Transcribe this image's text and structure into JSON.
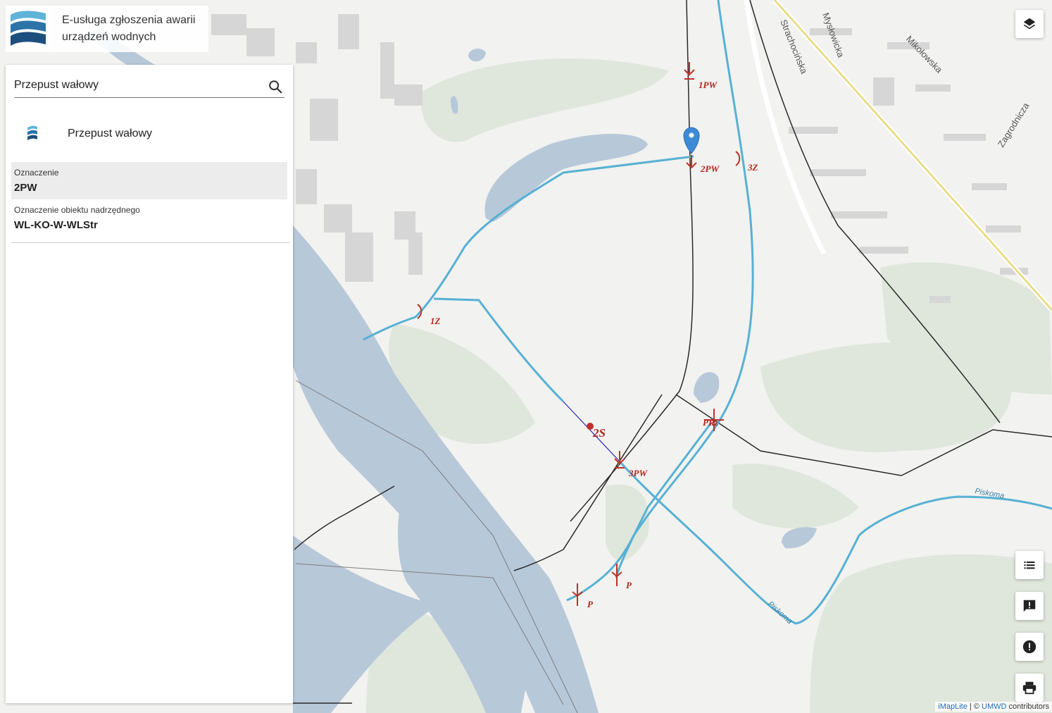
{
  "header": {
    "title": "E-usługa zgłoszenia awarii urządzeń wodnych"
  },
  "search": {
    "value": "Przepust wałowy",
    "placeholder": ""
  },
  "result": {
    "label": "Przepust wałowy"
  },
  "attributes": [
    {
      "name": "Oznaczenie",
      "value": "2PW"
    },
    {
      "name": "Oznaczenie obiektu nadrzędnego",
      "value": "WL-KO-W-WLStr"
    }
  ],
  "map": {
    "structure_labels": [
      "1PW",
      "2PW",
      "3Z",
      "1Z",
      "2S",
      "3PW",
      "PRz",
      "P",
      "P"
    ],
    "streets": [
      "Strachocińska",
      "Mysłowicka",
      "Mikołowska",
      "Zagrodnicza"
    ],
    "rivers": [
      "Piskoma",
      "Piskoma"
    ]
  },
  "attribution": {
    "lib": "iMapLite",
    "sep": "| ©",
    "org": "UMWD",
    "suffix": "contributors"
  },
  "colors": {
    "water_line": "#57b1d3",
    "river": "#b7c8d9",
    "structure": "#c0302a",
    "marker": "#3d8bd6"
  }
}
